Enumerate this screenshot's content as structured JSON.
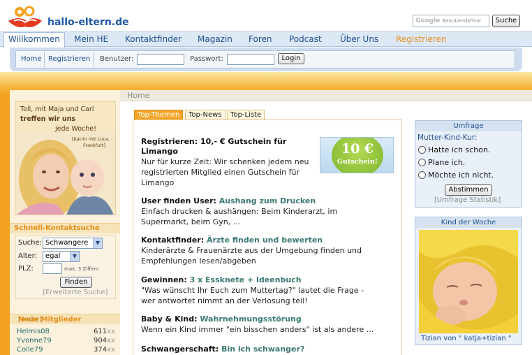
{
  "header": {
    "brand": "hallo-eltern.de",
    "search_brand": "Google",
    "search_placeholder": "Benutzerdefinie",
    "search_button": "Suche"
  },
  "nav": {
    "items": [
      {
        "label": "Willkommen",
        "active": true
      },
      {
        "label": "Mein HE"
      },
      {
        "label": "Kontaktfinder"
      },
      {
        "label": "Magazin"
      },
      {
        "label": "Foren"
      },
      {
        "label": "Podcast"
      },
      {
        "label": "Über Uns"
      },
      {
        "label": "Registrieren",
        "accent": true
      }
    ]
  },
  "login": {
    "home": "Home",
    "register": "Registrieren",
    "user_label": "Benutzer:",
    "user_value": "",
    "password_label": "Passwort:",
    "password_value": "",
    "button": "Login"
  },
  "breadcrumb": "Home",
  "promo": {
    "line1": "Toll, mit Maja und Carl",
    "line2": "treffen wir uns",
    "line3": "jede Woche!",
    "credit1": "[Katrin mit Luca,",
    "credit2": "Frankfurt]"
  },
  "schnellsuche": {
    "title": "Schnell-Kontaktsuche",
    "suche_label": "Suche:",
    "suche_value": "Schwangere",
    "alter_label": "Alter:",
    "alter_value": "egal",
    "plz_label": "PLZ:",
    "plz_hint": "max. 3 Ziffern",
    "button": "Finden",
    "advanced": "[Erweiterte Suche]"
  },
  "members": {
    "title": "Neue Mitglieder",
    "all_link": "[+alle]",
    "items": [
      {
        "name": "Helmis08",
        "points": "611",
        "suffix": "xx"
      },
      {
        "name": "Yvonne79",
        "points": "904",
        "suffix": "xx"
      },
      {
        "name": "Colle79",
        "points": "374",
        "suffix": "xx"
      }
    ]
  },
  "center": {
    "tabs": [
      "Top-Themen",
      "Top-News",
      "Top-Liste"
    ],
    "gutschein": {
      "amount": "10 €",
      "word": "Gutschein!"
    },
    "news": [
      {
        "title": "Registrieren: 10,- € Gutschein für",
        "title2": "Limango",
        "highlight": "",
        "lines": [
          "Nur für kurze Zeit: Wir schenken jedem neu",
          "registrierten Mitglied einen Gutschein für",
          "Limango"
        ]
      },
      {
        "title": "User finden User:",
        "highlight": "Aushang zum Drucken",
        "lines": [
          "Einfach drucken & aushängen: Beim Kinderarzt, im",
          "Supermarkt, beim Gyn, ..."
        ]
      },
      {
        "title": "Kontaktfinder:",
        "highlight": "Ärzte finden und bewerten",
        "lines": [
          "Kinderärzte & Frauenärzte aus der Umgebung finden und",
          "Empfehlungen lesen/abgeben"
        ]
      },
      {
        "title": "Gewinnen:",
        "highlight": "3 x Essknete + Ideenbuch",
        "lines": [
          "\"Was wünscht Ihr Euch zum Muttertag?\" lautet die Frage -",
          "wer antwortet nimmt an der Verlosung teil!"
        ]
      },
      {
        "title": "Baby & Kind:",
        "highlight": "Wahrnehmungsstörung",
        "lines": [
          "Wenn ein Kind immer \"ein bisschen anders\" ist als andere ..."
        ]
      },
      {
        "title": "Schwangerschaft:",
        "highlight": "Bin ich schwanger?",
        "lines": []
      }
    ]
  },
  "poll": {
    "title": "Umfrage",
    "question": "Mutter-Kind-Kur:",
    "options": [
      "Hatte ich schon.",
      "Plane ich.",
      "Möchte ich nicht."
    ],
    "button": "Abstimmen",
    "stats": "[Umfrage Statistik]"
  },
  "kind": {
    "title": "Kind der Woche",
    "caption": "Tizian von \" katja+tizian \""
  },
  "colors": {
    "brand_blue": "#1c5aa6",
    "accent_orange": "#f2a21f",
    "link_teal": "#3a7a74"
  }
}
